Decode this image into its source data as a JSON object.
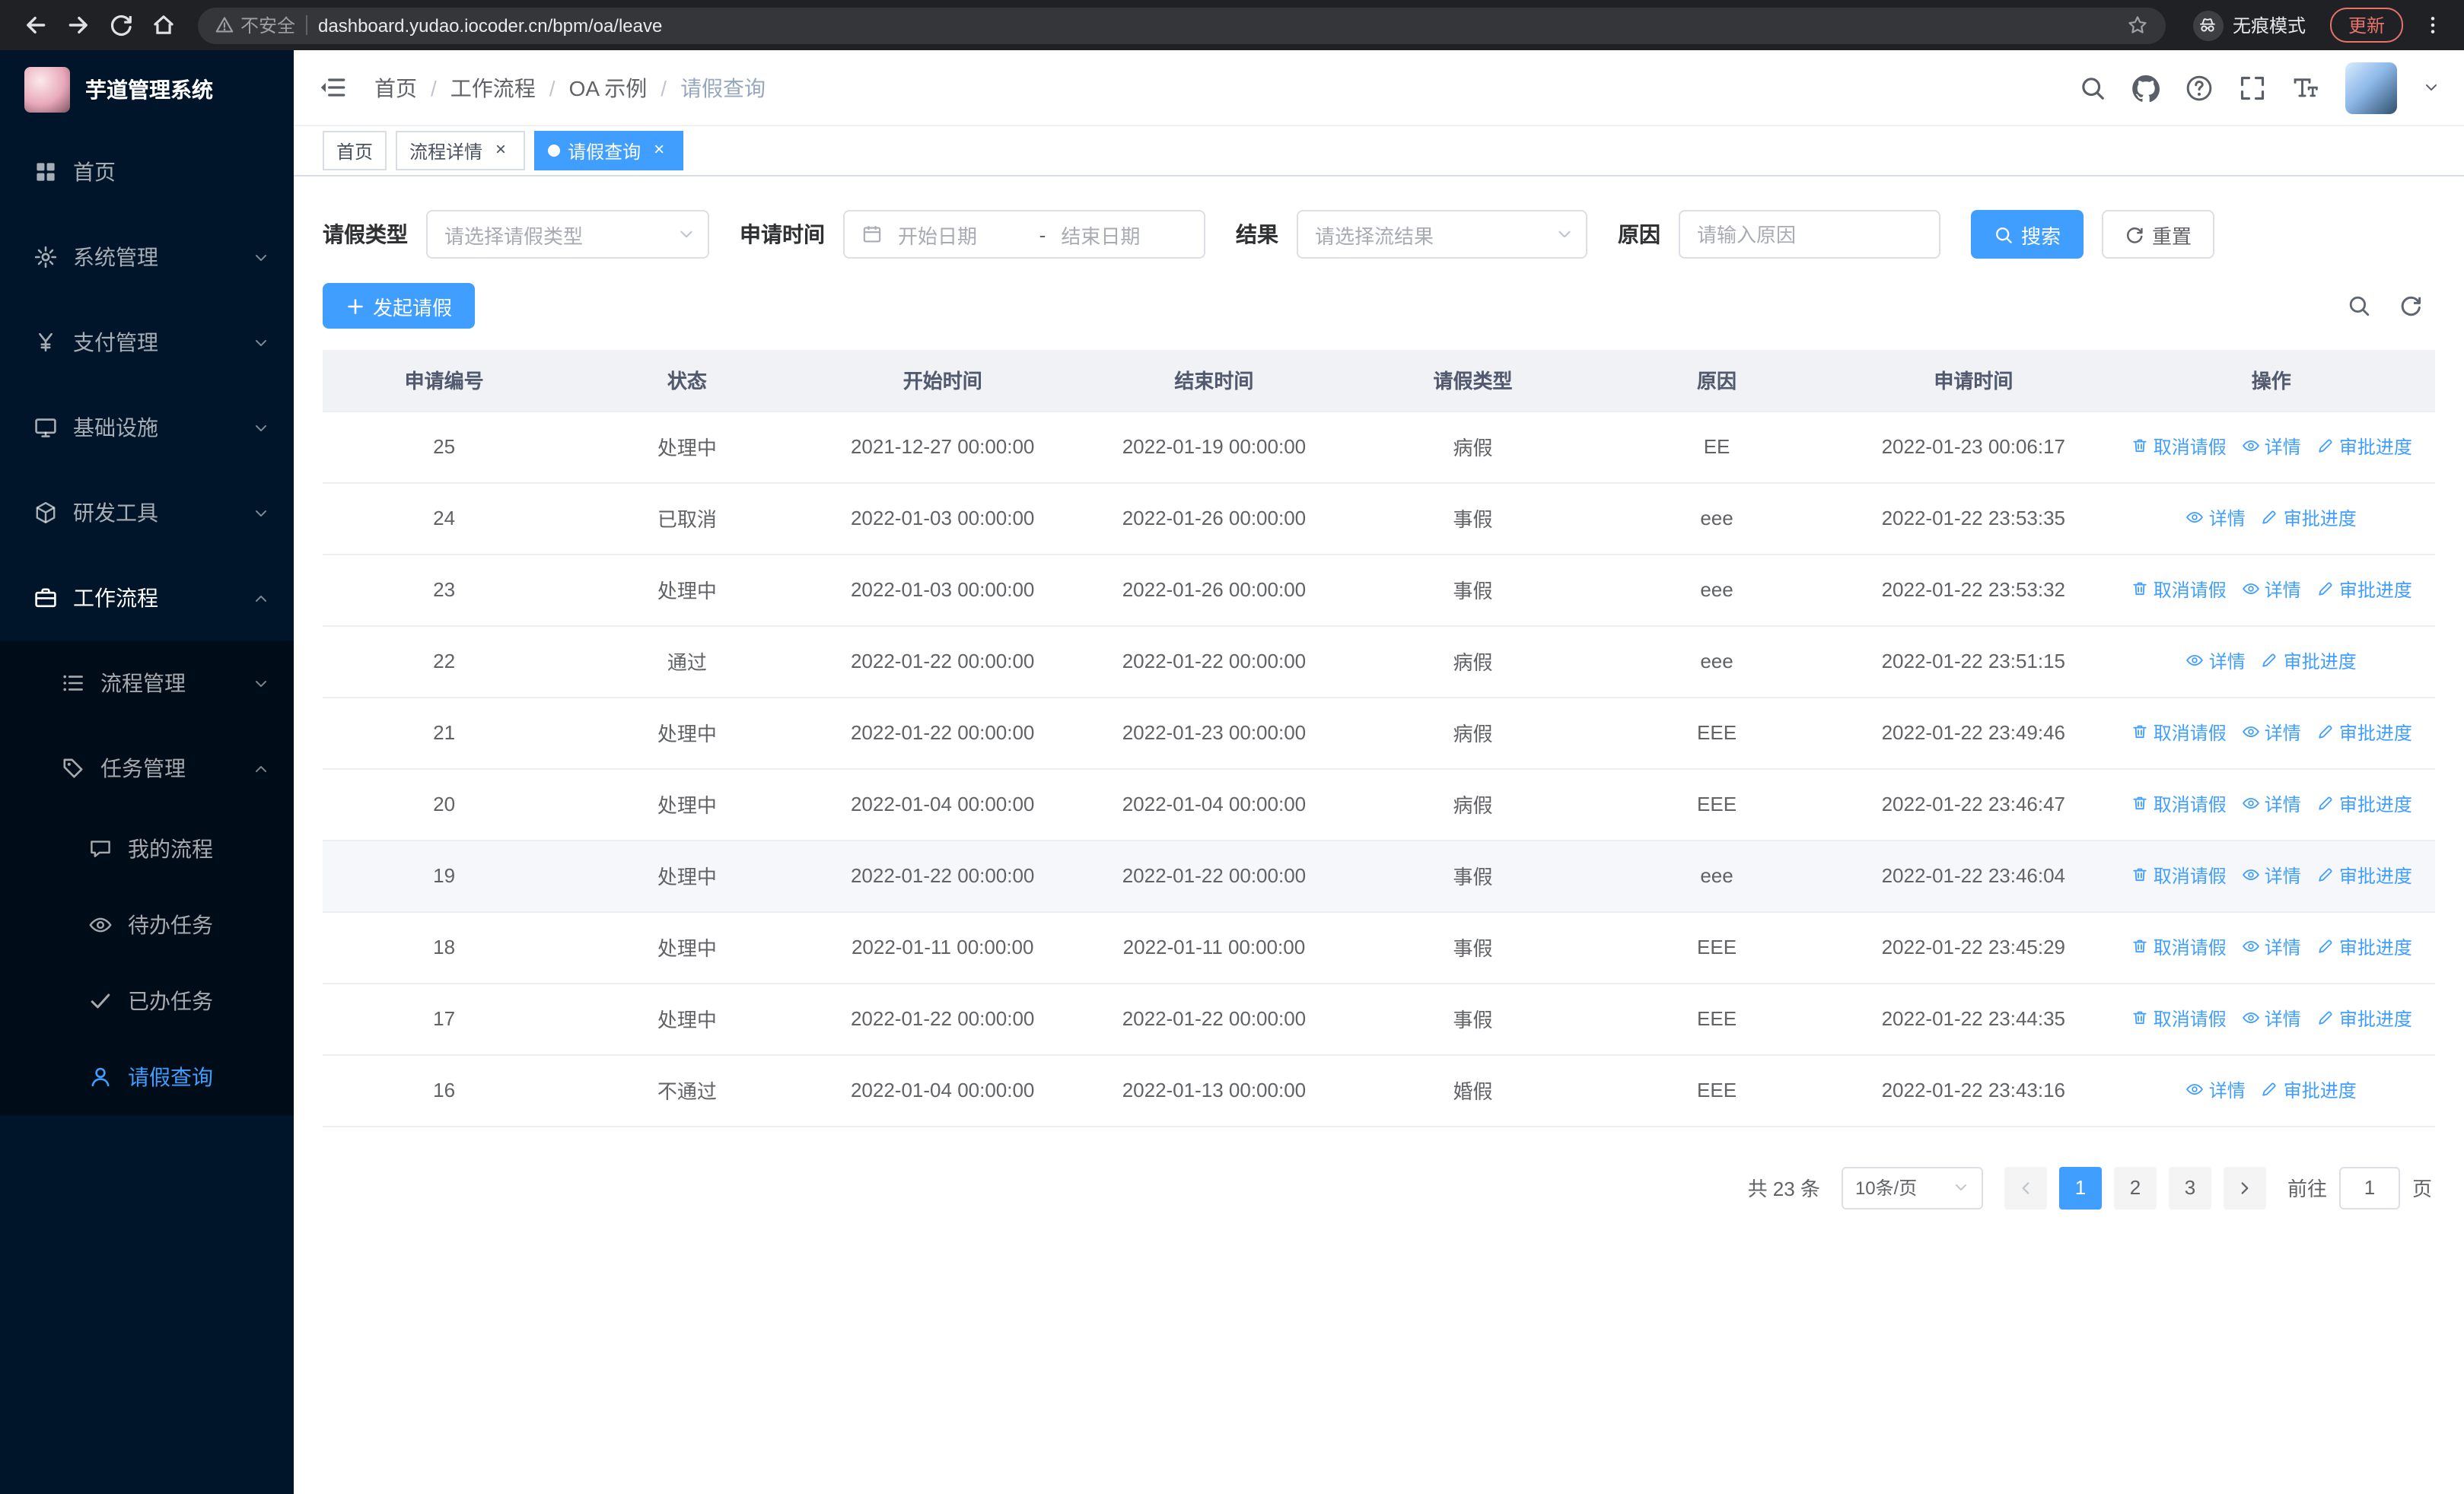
{
  "colors": {
    "primary": "#409eff",
    "sidebar_bg": "#001529",
    "submenu_bg": "#000c17"
  },
  "browser": {
    "nav_icons": [
      "back",
      "forward",
      "refresh",
      "home"
    ],
    "security_label": "不安全",
    "url": "dashboard.yudao.iocoder.cn/bpm/oa/leave",
    "incognito_label": "无痕模式",
    "update_label": "更新"
  },
  "sidebar": {
    "app_title": "芋道管理系统",
    "items": [
      {
        "label": "首页",
        "icon": "dashboard"
      },
      {
        "label": "系统管理",
        "icon": "gear"
      },
      {
        "label": "支付管理",
        "icon": "yen"
      },
      {
        "label": "基础设施",
        "icon": "monitor"
      },
      {
        "label": "研发工具",
        "icon": "cube"
      },
      {
        "label": "工作流程",
        "icon": "briefcase"
      }
    ],
    "submenu": [
      {
        "label": "流程管理",
        "icon": "list"
      },
      {
        "label": "任务管理",
        "icon": "tag"
      }
    ],
    "task_items": [
      {
        "label": "我的流程",
        "icon": "chat"
      },
      {
        "label": "待办任务",
        "icon": "eye"
      },
      {
        "label": "已办任务",
        "icon": "check"
      },
      {
        "label": "请假查询",
        "icon": "user"
      }
    ]
  },
  "header": {
    "breadcrumb": [
      "首页",
      "工作流程",
      "OA 示例",
      "请假查询"
    ],
    "icons": [
      "search",
      "github",
      "question",
      "fullscreen",
      "fontsize"
    ]
  },
  "tabs": [
    {
      "label": "首页"
    },
    {
      "label": "流程详情"
    },
    {
      "label": "请假查询"
    }
  ],
  "filters": {
    "leave_type_label": "请假类型",
    "leave_type_placeholder": "请选择请假类型",
    "apply_time_label": "申请时间",
    "start_date_placeholder": "开始日期",
    "date_separator": "-",
    "end_date_placeholder": "结束日期",
    "result_label": "结果",
    "result_placeholder": "请选择流结果",
    "reason_label": "原因",
    "reason_placeholder": "请输入原因",
    "search_label": "搜索",
    "reset_label": "重置"
  },
  "toolbar": {
    "create_label": "发起请假"
  },
  "table": {
    "columns": [
      "申请编号",
      "状态",
      "开始时间",
      "结束时间",
      "请假类型",
      "原因",
      "申请时间",
      "操作"
    ],
    "action_labels": {
      "cancel": "取消请假",
      "detail": "详情",
      "progress": "审批进度"
    },
    "action_icons": {
      "cancel": "trash",
      "detail": "eye",
      "progress": "pen"
    },
    "rows": [
      {
        "id": "25",
        "status": "处理中",
        "start": "2021-12-27 00:00:00",
        "end": "2022-01-19 00:00:00",
        "type": "病假",
        "reason": "EE",
        "applied": "2022-01-23 00:06:17",
        "actions": [
          "cancel",
          "detail",
          "progress"
        ],
        "highlight": false
      },
      {
        "id": "24",
        "status": "已取消",
        "start": "2022-01-03 00:00:00",
        "end": "2022-01-26 00:00:00",
        "type": "事假",
        "reason": "eee",
        "applied": "2022-01-22 23:53:35",
        "actions": [
          "detail",
          "progress"
        ],
        "highlight": false
      },
      {
        "id": "23",
        "status": "处理中",
        "start": "2022-01-03 00:00:00",
        "end": "2022-01-26 00:00:00",
        "type": "事假",
        "reason": "eee",
        "applied": "2022-01-22 23:53:32",
        "actions": [
          "cancel",
          "detail",
          "progress"
        ],
        "highlight": false
      },
      {
        "id": "22",
        "status": "通过",
        "start": "2022-01-22 00:00:00",
        "end": "2022-01-22 00:00:00",
        "type": "病假",
        "reason": "eee",
        "applied": "2022-01-22 23:51:15",
        "actions": [
          "detail",
          "progress"
        ],
        "highlight": false
      },
      {
        "id": "21",
        "status": "处理中",
        "start": "2022-01-22 00:00:00",
        "end": "2022-01-23 00:00:00",
        "type": "病假",
        "reason": "EEE",
        "applied": "2022-01-22 23:49:46",
        "actions": [
          "cancel",
          "detail",
          "progress"
        ],
        "highlight": false
      },
      {
        "id": "20",
        "status": "处理中",
        "start": "2022-01-04 00:00:00",
        "end": "2022-01-04 00:00:00",
        "type": "病假",
        "reason": "EEE",
        "applied": "2022-01-22 23:46:47",
        "actions": [
          "cancel",
          "detail",
          "progress"
        ],
        "highlight": false
      },
      {
        "id": "19",
        "status": "处理中",
        "start": "2022-01-22 00:00:00",
        "end": "2022-01-22 00:00:00",
        "type": "事假",
        "reason": "eee",
        "applied": "2022-01-22 23:46:04",
        "actions": [
          "cancel",
          "detail",
          "progress"
        ],
        "highlight": true
      },
      {
        "id": "18",
        "status": "处理中",
        "start": "2022-01-11 00:00:00",
        "end": "2022-01-11 00:00:00",
        "type": "事假",
        "reason": "EEE",
        "applied": "2022-01-22 23:45:29",
        "actions": [
          "cancel",
          "detail",
          "progress"
        ],
        "highlight": false
      },
      {
        "id": "17",
        "status": "处理中",
        "start": "2022-01-22 00:00:00",
        "end": "2022-01-22 00:00:00",
        "type": "事假",
        "reason": "EEE",
        "applied": "2022-01-22 23:44:35",
        "actions": [
          "cancel",
          "detail",
          "progress"
        ],
        "highlight": false
      },
      {
        "id": "16",
        "status": "不通过",
        "start": "2022-01-04 00:00:00",
        "end": "2022-01-13 00:00:00",
        "type": "婚假",
        "reason": "EEE",
        "applied": "2022-01-22 23:43:16",
        "actions": [
          "detail",
          "progress"
        ],
        "highlight": false
      }
    ]
  },
  "pagination": {
    "total_label": "共 23 条",
    "page_size": "10条/页",
    "pages": [
      "1",
      "2",
      "3"
    ],
    "active_page": "1",
    "goto_label": "前往",
    "goto_value": "1",
    "page_label": "页"
  }
}
